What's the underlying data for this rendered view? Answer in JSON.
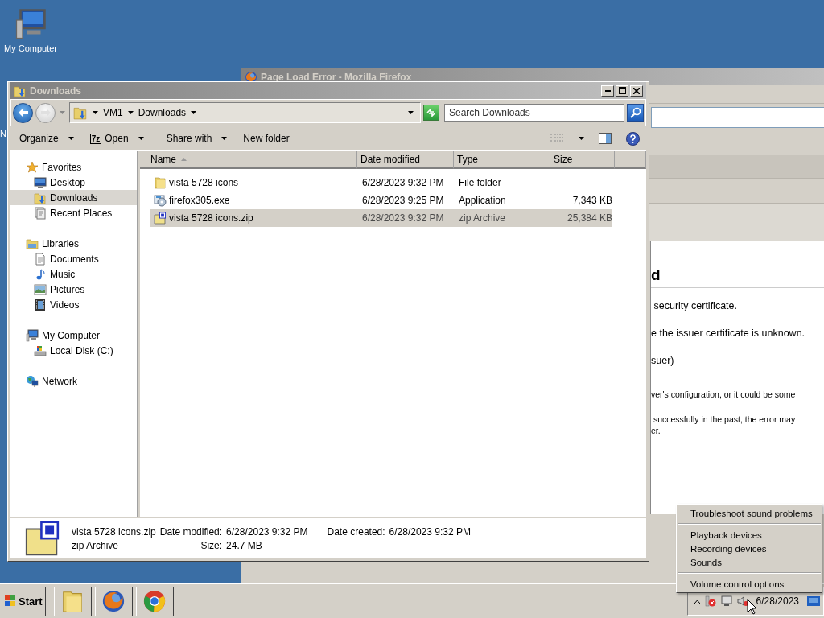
{
  "desktop": {
    "icons": [
      {
        "label": "My Computer",
        "kind": "computer"
      },
      {
        "label": "N",
        "kind": "hidden"
      }
    ]
  },
  "firefox_window": {
    "title": "Page Load Error - Mozilla Firefox",
    "page": {
      "heading": "d",
      "lines": [
        " security certificate.",
        "e the issuer certificate is unknown.",
        "suer)"
      ],
      "paragraphs": [
        [
          "ver's configuration, or it could be some"
        ],
        [
          " successfully in the past, the error may",
          "er."
        ]
      ]
    }
  },
  "explorer": {
    "title": "Downloads",
    "breadcrumb": [
      "VM1",
      "Downloads"
    ],
    "search": {
      "placeholder": "Search Downloads"
    },
    "commands": [
      {
        "label": "Organize",
        "dropdown": true
      },
      {
        "label": "Open",
        "badge": "7z",
        "dropdown": true
      },
      {
        "label": "Share with",
        "dropdown": true
      },
      {
        "label": "New folder",
        "dropdown": false
      }
    ],
    "sidebar": [
      {
        "label": "Favorites",
        "kind": "favorites",
        "selected": false,
        "children": [
          {
            "label": "Desktop",
            "kind": "desktop",
            "selected": false
          },
          {
            "label": "Downloads",
            "kind": "downloads",
            "selected": true
          },
          {
            "label": "Recent Places",
            "kind": "recent",
            "selected": false
          }
        ]
      },
      {
        "label": "Libraries",
        "kind": "libraries",
        "selected": false,
        "children": [
          {
            "label": "Documents",
            "kind": "documents",
            "selected": false
          },
          {
            "label": "Music",
            "kind": "music",
            "selected": false
          },
          {
            "label": "Pictures",
            "kind": "pictures",
            "selected": false
          },
          {
            "label": "Videos",
            "kind": "videos",
            "selected": false
          }
        ]
      },
      {
        "label": "My Computer",
        "kind": "computer",
        "selected": false,
        "children": [
          {
            "label": "Local Disk (C:)",
            "kind": "disk",
            "selected": false
          }
        ]
      },
      {
        "label": "Network",
        "kind": "network",
        "selected": false
      }
    ],
    "columns": [
      {
        "label": "Name",
        "sorted": true
      },
      {
        "label": "Date modified",
        "sorted": false
      },
      {
        "label": "Type",
        "sorted": false
      },
      {
        "label": "Size",
        "sorted": false
      }
    ],
    "files": [
      {
        "name": "vista 5728 icons",
        "date": "6/28/2023 9:32 PM",
        "type": "File folder",
        "kind": "folder",
        "selected": false
      },
      {
        "name": "firefox305.exe",
        "date": "6/28/2023 9:25 PM",
        "type": "Application",
        "size": "7,343 KB",
        "kind": "exe",
        "selected": false
      },
      {
        "name": "vista 5728 icons.zip",
        "date": "6/28/2023 9:32 PM",
        "type": "zip Archive",
        "size": "25,384 KB",
        "kind": "zip",
        "selected": true
      }
    ],
    "details": {
      "name": "vista 5728 icons.zip",
      "type": "zip Archive",
      "kind": "zip",
      "rows": [
        [
          {
            "label": "Date modified:",
            "value": "6/28/2023 9:32 PM"
          },
          {
            "label": "Date created:",
            "value": "6/28/2023 9:32 PM"
          }
        ],
        [
          {
            "label": "Size:",
            "value": "24.7 MB"
          }
        ]
      ]
    }
  },
  "taskbar": {
    "start": "Start",
    "quick_launch": [
      {
        "kind": "folder"
      },
      {
        "kind": "firefox"
      },
      {
        "kind": "chrome"
      }
    ],
    "clock": "6/28/2023"
  },
  "sound_menu": {
    "groups": [
      [
        "Troubleshoot sound problems"
      ],
      [
        "Playback devices",
        "Recording devices",
        "Sounds"
      ],
      [
        "Volume control options"
      ]
    ]
  }
}
